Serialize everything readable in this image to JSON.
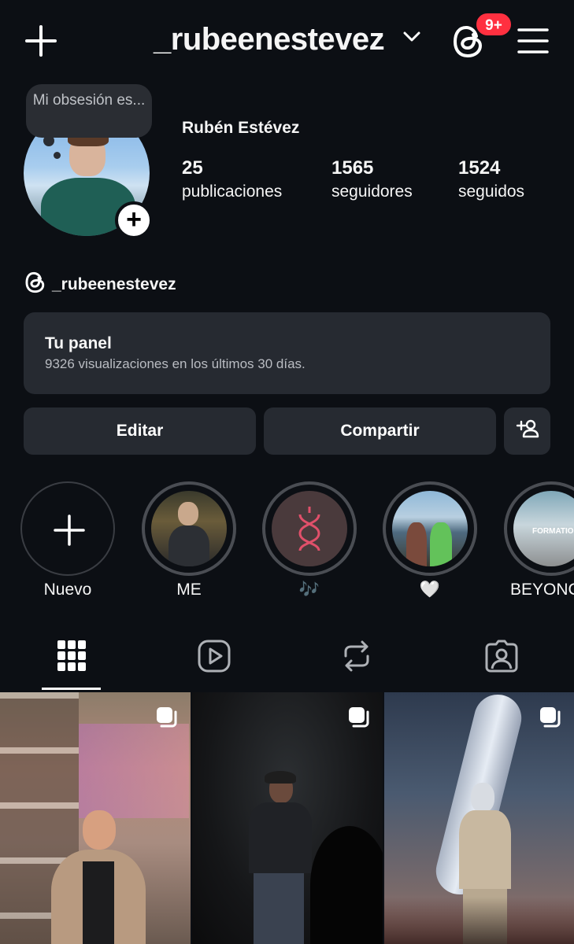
{
  "header": {
    "username": "_rubeenestevez",
    "notifications_badge": "9+",
    "icons": [
      "plus-icon",
      "chevron-down-icon",
      "threads-icon",
      "hamburger-menu-icon"
    ]
  },
  "profile": {
    "note_text": "Mi obsesión es...",
    "full_name": "Rubén Estévez",
    "stats": [
      {
        "value": "25",
        "label": "publicaciones"
      },
      {
        "value": "1565",
        "label": "seguidores"
      },
      {
        "value": "1524",
        "label": "seguidos"
      }
    ],
    "threads_handle": "_rubeenestevez"
  },
  "panel": {
    "title": "Tu panel",
    "subtitle": "9326 visualizaciones en los últimos 30 días."
  },
  "buttons": {
    "edit": "Editar",
    "share": "Compartir"
  },
  "highlights": [
    {
      "label": "Nuevo"
    },
    {
      "label": "ME"
    },
    {
      "label": "🎶"
    },
    {
      "label": "🤍"
    },
    {
      "label": "BEYONC"
    }
  ],
  "highlight_cover_text": "FORMATION",
  "tabs": [
    "grid-icon",
    "reels-icon",
    "reposts-icon",
    "tagged-icon"
  ],
  "colors": {
    "background": "#0c0f14",
    "surface": "#262a31",
    "badge": "#ff3040",
    "text": "#f5f5f5"
  }
}
